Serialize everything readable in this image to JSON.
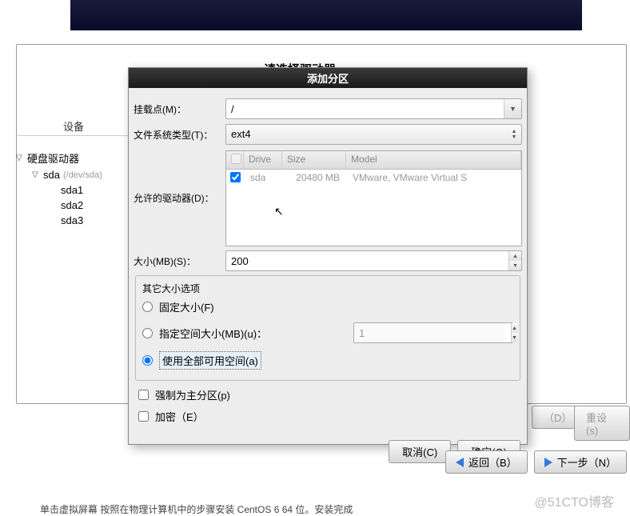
{
  "background": {
    "title_partial": "请选择驱动器",
    "device_header": "设备",
    "tree": {
      "root": "硬盘驱动器",
      "disk": "sda",
      "disk_dev": "(/dev/sda)",
      "parts": [
        "sda1",
        "sda2",
        "sda3"
      ]
    },
    "btn_d": "（D）",
    "btn_reset": "重设(s)",
    "btn_back": "返回（B）",
    "btn_next": "下一步（N）"
  },
  "modal": {
    "title": "添加分区",
    "mount_label": "挂载点(M)：",
    "mount_value": "/",
    "fstype_label": "文件系统类型(T)：",
    "fstype_value": "ext4",
    "drives_label": "允许的驱动器(D)：",
    "drive_headers": {
      "drive": "Drive",
      "size": "Size",
      "model": "Model"
    },
    "drive_row": {
      "checked": true,
      "drive": "sda",
      "size": "20480 MB",
      "model": "VMware, VMware Virtual S"
    },
    "size_label": "大小(MB)(S)：",
    "size_value": "200",
    "other_legend": "其它大小选项",
    "radio_fixed": "固定大小(F)",
    "radio_fill": "指定空间大小(MB)(u)：",
    "radio_fill_value": "1",
    "radio_all": "使用全部可用空间(a)",
    "chk_primary": "强制为主分区(p)",
    "chk_encrypt": "加密（E）",
    "btn_cancel": "取消(C)",
    "btn_ok": "确定(O)"
  },
  "watermark": "@51CTO博客",
  "footer": "单击虚拟屏幕   按照在物理计算机中的步骤安装 CentOS 6 64 位。安装完成"
}
